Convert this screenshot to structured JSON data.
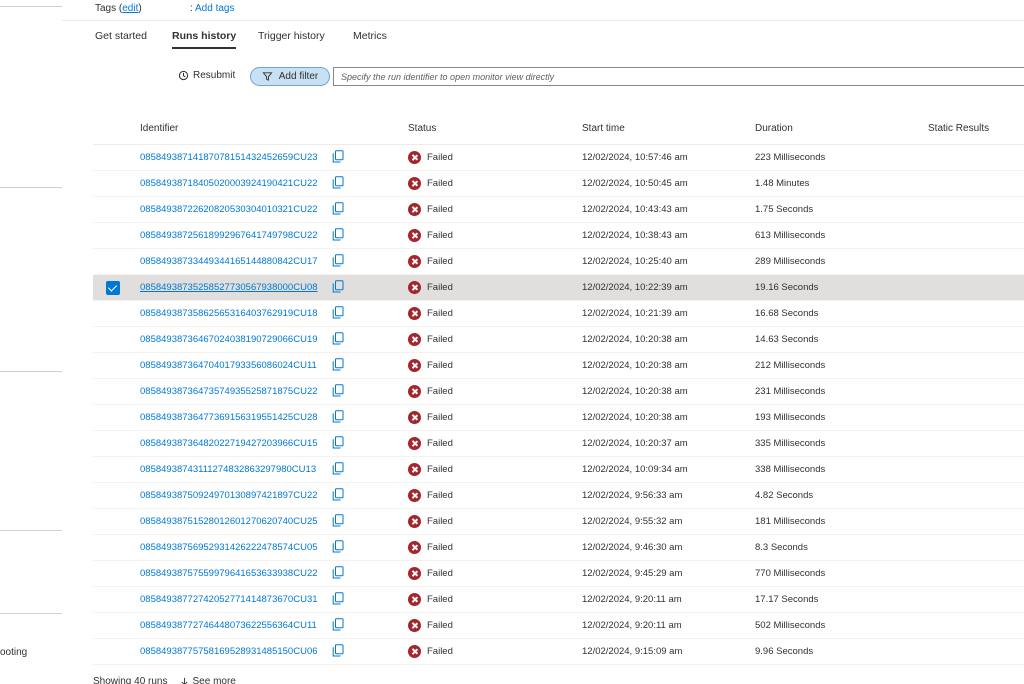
{
  "left_rail": {
    "partial_text": "ooting"
  },
  "tags": {
    "label": "Tags",
    "edit_link": "edit",
    "add_tags": "Add tags"
  },
  "tabs": [
    {
      "label": "Get started"
    },
    {
      "label": "Runs history"
    },
    {
      "label": "Trigger history"
    },
    {
      "label": "Metrics"
    }
  ],
  "toolbar": {
    "resubmit_label": "Resubmit",
    "add_filter_label": "Add filter",
    "search_placeholder": "Specify the run identifier to open monitor view directly"
  },
  "table": {
    "columns": [
      "Identifier",
      "Status",
      "Start time",
      "Duration",
      "Static Results"
    ],
    "selected_index": 5,
    "rows": [
      {
        "id": "08584938714187078151432452659CU23",
        "status": "Failed",
        "start": "12/02/2024, 10:57:46 am",
        "duration": "223 Milliseconds"
      },
      {
        "id": "08584938718405020003924190421CU22",
        "status": "Failed",
        "start": "12/02/2024, 10:50:45 am",
        "duration": "1.48 Minutes"
      },
      {
        "id": "08584938722620820530304010321CU22",
        "status": "Failed",
        "start": "12/02/2024, 10:43:43 am",
        "duration": "1.75 Seconds"
      },
      {
        "id": "08584938725618992967641749798CU22",
        "status": "Failed",
        "start": "12/02/2024, 10:38:43 am",
        "duration": "613 Milliseconds"
      },
      {
        "id": "08584938733449344165144880842CU17",
        "status": "Failed",
        "start": "12/02/2024, 10:25:40 am",
        "duration": "289 Milliseconds"
      },
      {
        "id": "08584938735258527730567938000CU08",
        "status": "Failed",
        "start": "12/02/2024, 10:22:39 am",
        "duration": "19.16 Seconds"
      },
      {
        "id": "08584938735862565316403762919CU18",
        "status": "Failed",
        "start": "12/02/2024, 10:21:39 am",
        "duration": "16.68 Seconds"
      },
      {
        "id": "08584938736467024038190729066CU19",
        "status": "Failed",
        "start": "12/02/2024, 10:20:38 am",
        "duration": "14.63 Seconds"
      },
      {
        "id": "08584938736470401793356086024CU11",
        "status": "Failed",
        "start": "12/02/2024, 10:20:38 am",
        "duration": "212 Milliseconds"
      },
      {
        "id": "08584938736473574935525871875CU22",
        "status": "Failed",
        "start": "12/02/2024, 10:20:38 am",
        "duration": "231 Milliseconds"
      },
      {
        "id": "08584938736477369156319551425CU28",
        "status": "Failed",
        "start": "12/02/2024, 10:20:38 am",
        "duration": "193 Milliseconds"
      },
      {
        "id": "08584938736482022719427203966CU15",
        "status": "Failed",
        "start": "12/02/2024, 10:20:37 am",
        "duration": "335 Milliseconds"
      },
      {
        "id": "08584938743111274832863297980CU13",
        "status": "Failed",
        "start": "12/02/2024, 10:09:34 am",
        "duration": "338 Milliseconds"
      },
      {
        "id": "08584938750924970130897421897CU22",
        "status": "Failed",
        "start": "12/02/2024, 9:56:33 am",
        "duration": "4.82 Seconds"
      },
      {
        "id": "08584938751528012601270620740CU25",
        "status": "Failed",
        "start": "12/02/2024, 9:55:32 am",
        "duration": "181 Milliseconds"
      },
      {
        "id": "08584938756952931426222478574CU05",
        "status": "Failed",
        "start": "12/02/2024, 9:46:30 am",
        "duration": "8.3 Seconds"
      },
      {
        "id": "08584938757559979641653633938CU22",
        "status": "Failed",
        "start": "12/02/2024, 9:45:29 am",
        "duration": "770 Milliseconds"
      },
      {
        "id": "08584938772742052771414873670CU31",
        "status": "Failed",
        "start": "12/02/2024, 9:20:11 am",
        "duration": "17.17 Seconds"
      },
      {
        "id": "08584938772746448073622556364CU11",
        "status": "Failed",
        "start": "12/02/2024, 9:20:11 am",
        "duration": "502 Milliseconds"
      },
      {
        "id": "08584938775758169528931485150CU06",
        "status": "Failed",
        "start": "12/02/2024, 9:15:09 am",
        "duration": "9.96 Seconds"
      }
    ]
  },
  "footer": {
    "showing": "Showing 40 runs",
    "see_more": "See more"
  },
  "colors": {
    "accent": "#0078d4",
    "failed": "#a4262c",
    "filter_bg": "#c7e0f4",
    "selected_row": "#e1dfdd"
  },
  "icons": {
    "resubmit": "resubmit-icon",
    "filter": "filter-icon",
    "copy": "copy-icon",
    "failed": "failed-status-icon",
    "arrow_down": "arrow-down-icon"
  }
}
